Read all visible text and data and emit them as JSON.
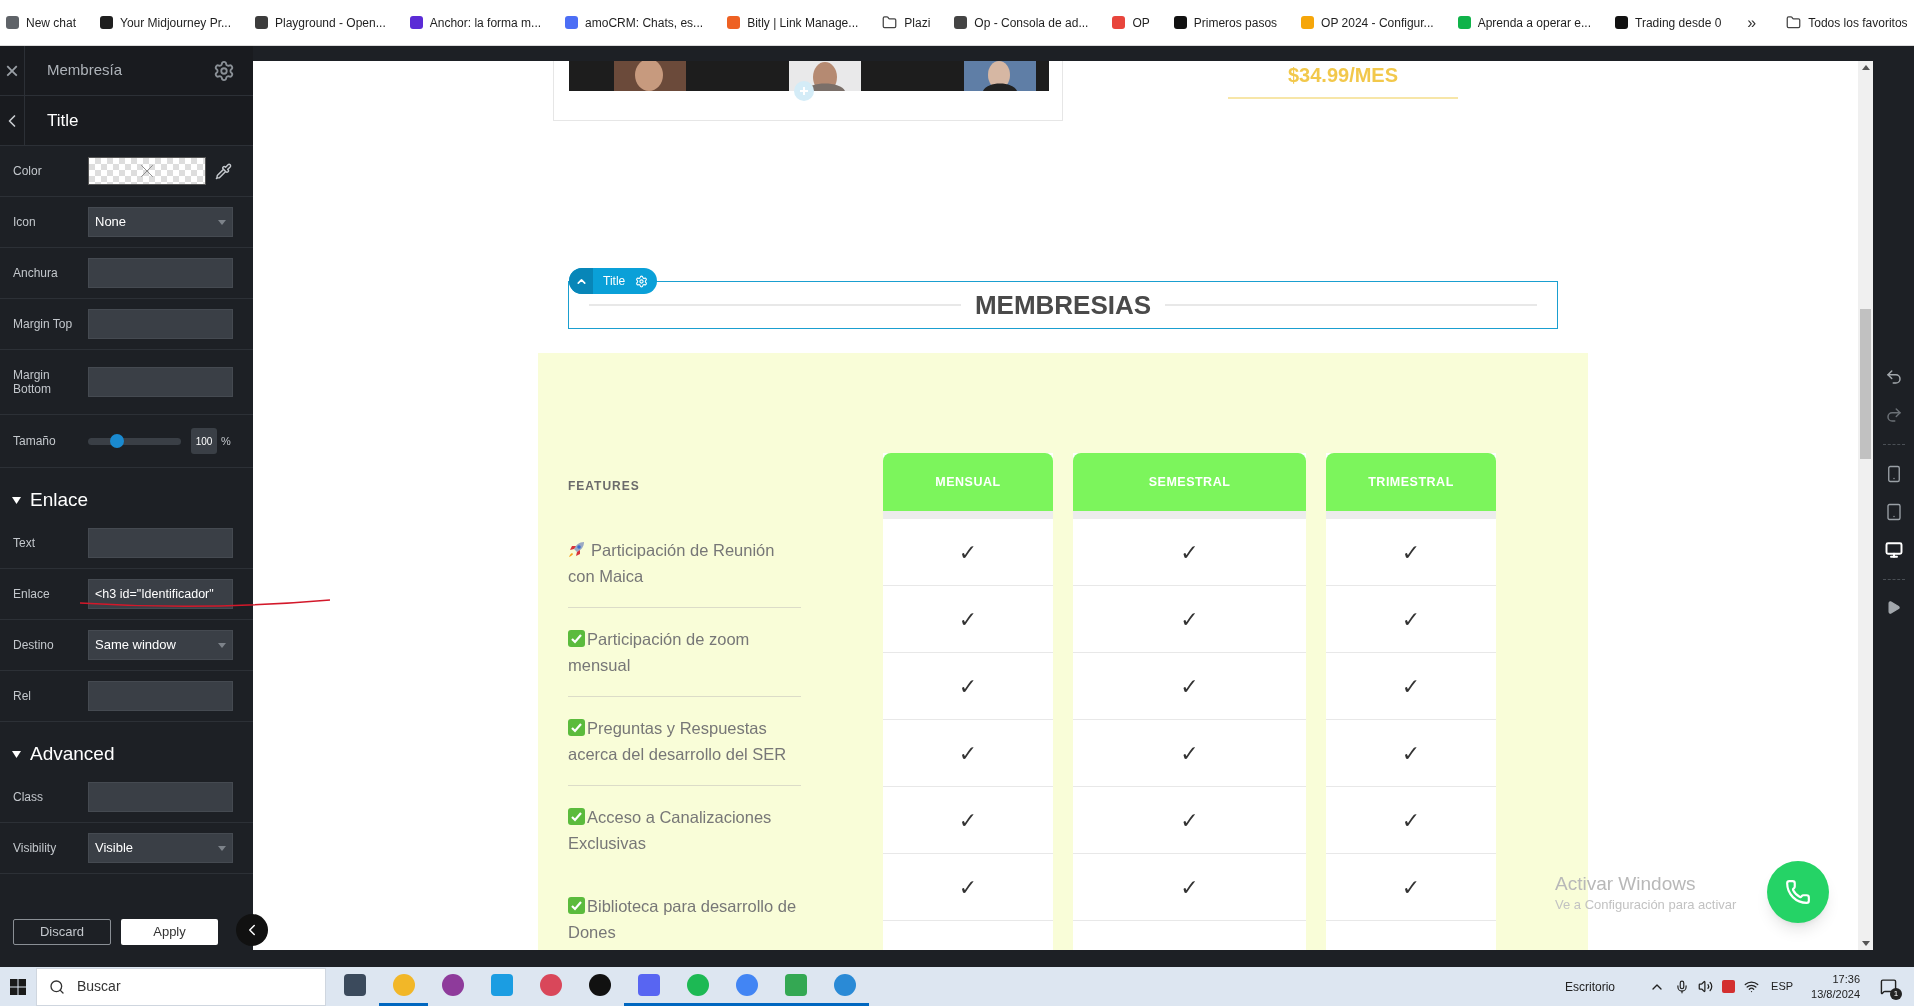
{
  "bookmarks": {
    "items": [
      {
        "label": "New chat",
        "kind": "site",
        "color": "#5f6368"
      },
      {
        "label": "Your Midjourney Pr...",
        "kind": "site",
        "color": "#1f1f1f"
      },
      {
        "label": "Playground - Open...",
        "kind": "site",
        "color": "#3c3c3c"
      },
      {
        "label": "Anchor: la forma m...",
        "kind": "site",
        "color": "#5b2bd6"
      },
      {
        "label": "amoCRM: Chats, es...",
        "kind": "site",
        "color": "#4c6ef5"
      },
      {
        "label": "Bitly | Link Manage...",
        "kind": "site",
        "color": "#ee6123"
      },
      {
        "label": "Plazi",
        "kind": "folder"
      },
      {
        "label": "Op - Consola de ad...",
        "kind": "site",
        "color": "#444444"
      },
      {
        "label": "OP",
        "kind": "site",
        "color": "#e8453c"
      },
      {
        "label": "Primeros pasos",
        "kind": "site",
        "color": "#111111"
      },
      {
        "label": "OP 2024 - Configur...",
        "kind": "site",
        "color": "#f6a609"
      },
      {
        "label": "Aprenda a operar e...",
        "kind": "site",
        "color": "#10b34a"
      },
      {
        "label": "Trading desde 0",
        "kind": "site",
        "color": "#111111"
      }
    ],
    "more": "»",
    "all": {
      "label": "Todos los favoritos",
      "kind": "folder"
    }
  },
  "sidebar": {
    "close": "×",
    "title": "Membresía",
    "subtitle": "Title",
    "rows": [
      {
        "kind": "color",
        "label": "Color"
      },
      {
        "kind": "select",
        "label": "Icon",
        "value": "None"
      },
      {
        "kind": "input",
        "label": "Anchura"
      },
      {
        "kind": "input",
        "label": "Margin Top"
      },
      {
        "kind": "input",
        "label": "Margin Bottom"
      },
      {
        "kind": "slider",
        "label": "Tamaño",
        "level": 0.31,
        "value": "100",
        "unit": "%"
      },
      {
        "kind": "heading",
        "label": "Enlace",
        "expanded": true
      },
      {
        "kind": "input",
        "label": "Text"
      },
      {
        "kind": "input",
        "label": "Enlace",
        "value": "<h3 id=\"Identificador\""
      },
      {
        "kind": "select",
        "label": "Destino",
        "value": "Same window"
      },
      {
        "kind": "input",
        "label": "Rel"
      },
      {
        "kind": "heading",
        "label": "Advanced",
        "expanded": true
      },
      {
        "kind": "input",
        "label": "Class"
      },
      {
        "kind": "select",
        "label": "Visibility",
        "value": "Visible"
      }
    ],
    "buttons": [
      {
        "label": "Discard",
        "kind": "secondary"
      },
      {
        "label": "Apply",
        "kind": "primary"
      }
    ]
  },
  "canvas": {
    "price": "$34.99/MES",
    "title_badge": "Title",
    "heading": "MEMBRESIAS",
    "table": {
      "features_label": "FEATURES",
      "features": [
        {
          "kind": "rocket",
          "text": "Participación de Reunión con Maica",
          "separator": true
        },
        {
          "kind": "check",
          "text": "Participación de zoom mensual",
          "separator": true
        },
        {
          "kind": "check",
          "text": "Preguntas y Respuestas acerca del desarrollo del SER",
          "separator": true
        },
        {
          "kind": "check",
          "text": "Acceso a Canalizaciones Exclusivas",
          "separator": false
        },
        {
          "kind": "check",
          "text": "Biblioteca para desarrollo de Dones"
        }
      ],
      "plans": [
        {
          "name": "MENSUAL",
          "cells": [
            "✓",
            "✓",
            "✓",
            "✓",
            "✓",
            "✓"
          ]
        },
        {
          "name": "SEMESTRAL",
          "cells": [
            "✓",
            "✓",
            "✓",
            "✓",
            "✓",
            "✓"
          ]
        },
        {
          "name": "TRIMESTRAL",
          "cells": [
            "✓",
            "✓",
            "✓",
            "✓",
            "✓",
            "✓"
          ]
        }
      ]
    },
    "activation": {
      "title": "Activar Windows",
      "text": "Ve a Configuración para activar"
    }
  },
  "toolbar": {
    "devices": [
      {
        "kind": "phone",
        "selected": false
      },
      {
        "kind": "tablet",
        "selected": false
      },
      {
        "kind": "desktop",
        "selected": true
      }
    ]
  },
  "taskbar": {
    "search": "Buscar",
    "apps": [
      {
        "color": "#3b4a5c",
        "running": false
      },
      {
        "color": "#f2b728",
        "running": true
      },
      {
        "color": "#8e3b9b",
        "running": false
      },
      {
        "color": "#1b9de2",
        "running": false
      },
      {
        "color": "#d9475a",
        "running": false
      },
      {
        "color": "#111111",
        "running": false
      },
      {
        "color": "#5865f2",
        "running": true
      },
      {
        "color": "#1db954",
        "running": true
      },
      {
        "color": "#4285f4",
        "running": true
      },
      {
        "color": "#34a853",
        "running": true
      },
      {
        "color": "#2a8ad6",
        "running": true
      }
    ],
    "desktop": "Escritorio",
    "language": "ESP",
    "time": "17:36",
    "date": "13/8/2024",
    "notifications": "1"
  }
}
